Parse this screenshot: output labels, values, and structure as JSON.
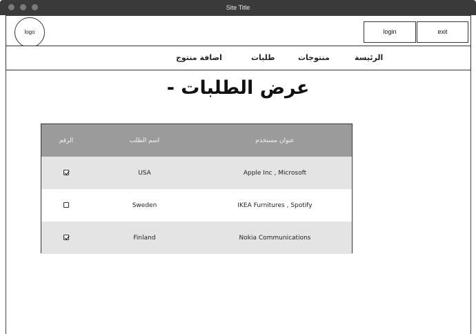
{
  "window": {
    "title": "Site Title"
  },
  "header": {
    "logo_label": "logo",
    "login_label": "login",
    "exit_label": "exit"
  },
  "nav": {
    "items": [
      "الرئيسة",
      "منتوجات",
      "طلبات",
      "اضافة منتوج"
    ]
  },
  "page": {
    "title": "عرض الطلبات -"
  },
  "table": {
    "headers": [
      "الرقم",
      "اسم الطلب",
      "عنوان مستخدم"
    ],
    "rows": [
      {
        "checked": true,
        "name": "USA",
        "address": "Apple Inc , Microsoft"
      },
      {
        "checked": false,
        "name": "Sweden",
        "address": "IKEA Furnitures , Spotify"
      },
      {
        "checked": true,
        "name": "Finland",
        "address": "Nokia Communications"
      }
    ]
  }
}
